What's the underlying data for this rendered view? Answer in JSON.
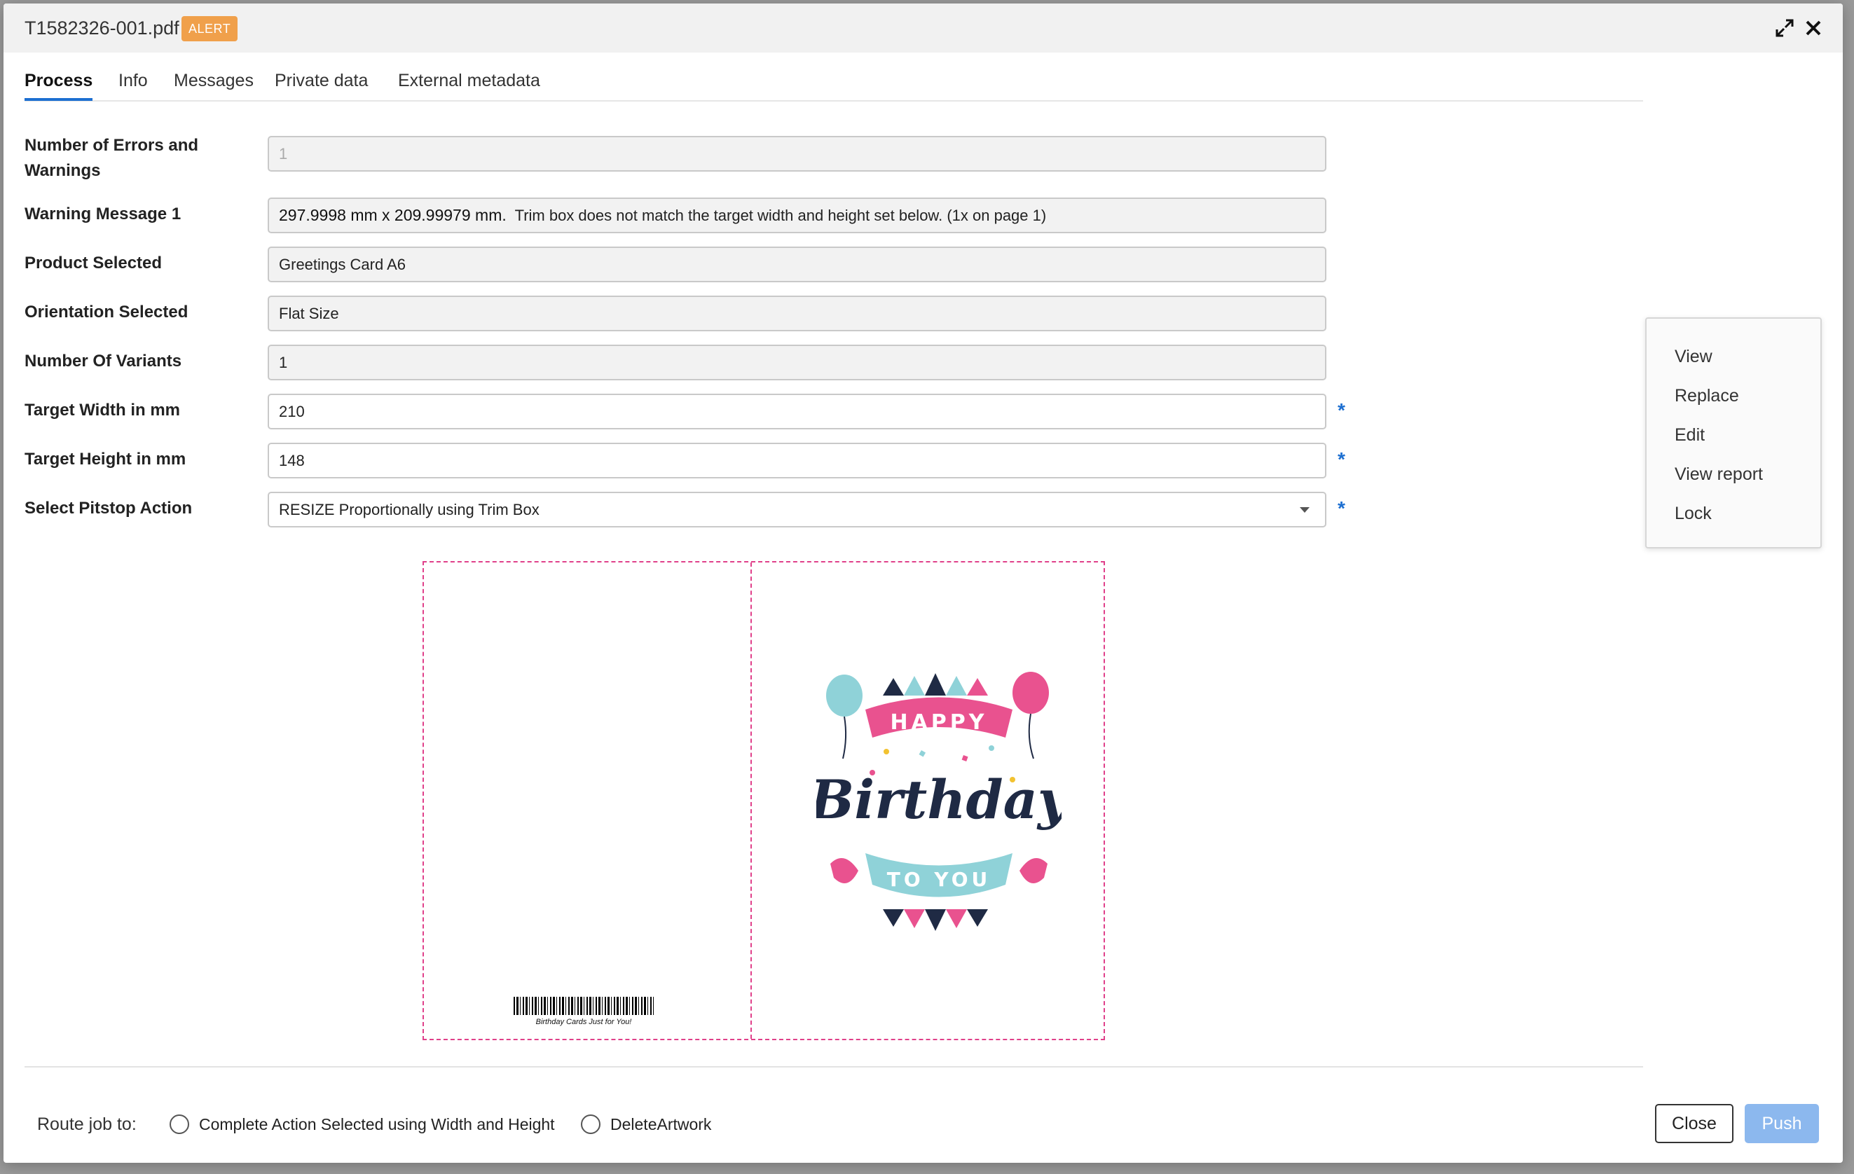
{
  "header": {
    "file_name": "T1582326-001.pdf",
    "badge": "ALERT",
    "expand_icon": "expand-icon",
    "close_icon": "close-icon"
  },
  "tabs": [
    {
      "label": "Process",
      "active": true
    },
    {
      "label": "Info",
      "active": false
    },
    {
      "label": "Messages",
      "active": false
    },
    {
      "label": "Private data",
      "active": false
    },
    {
      "label": "External metadata",
      "active": false
    }
  ],
  "form": {
    "errors": {
      "label_line1": "Number of Errors and",
      "label_line2": "Warnings",
      "value": "1"
    },
    "warning1": {
      "label": "Warning Message 1",
      "value_size": "297.9998 mm x 209.99979 mm.",
      "value_text": "  Trim box does not match the target width and height set below. (1x on page 1)"
    },
    "product": {
      "label": "Product Selected",
      "value": "Greetings Card A6"
    },
    "orientation": {
      "label": "Orientation Selected",
      "value": "Flat Size"
    },
    "variants": {
      "label": "Number Of Variants",
      "value": "1"
    },
    "target_width": {
      "label": "Target Width in mm",
      "value": "210",
      "required": "*"
    },
    "target_height": {
      "label": "Target Height in mm",
      "value": "148",
      "required": "*"
    },
    "pitstop": {
      "label": "Select Pitstop Action",
      "value": "RESIZE Proportionally using Trim Box",
      "required": "*"
    }
  },
  "context_menu": [
    "View",
    "Replace",
    "Edit",
    "View report",
    "Lock"
  ],
  "preview": {
    "barcode_caption": "Birthday Cards Just for You!",
    "art_top": "HAPPY",
    "art_main": "Birthday",
    "art_bottom": "TO YOU"
  },
  "footer": {
    "route_label": "Route job to:",
    "options": [
      "Complete Action Selected using Width and Height",
      "DeleteArtwork"
    ],
    "close_button": "Close",
    "push_button": "Push"
  },
  "colors": {
    "accent": "#1d6fd1",
    "alert": "#f0a04b",
    "trim_line": "#e0408a",
    "push_disabled": "#8cb8ee"
  }
}
